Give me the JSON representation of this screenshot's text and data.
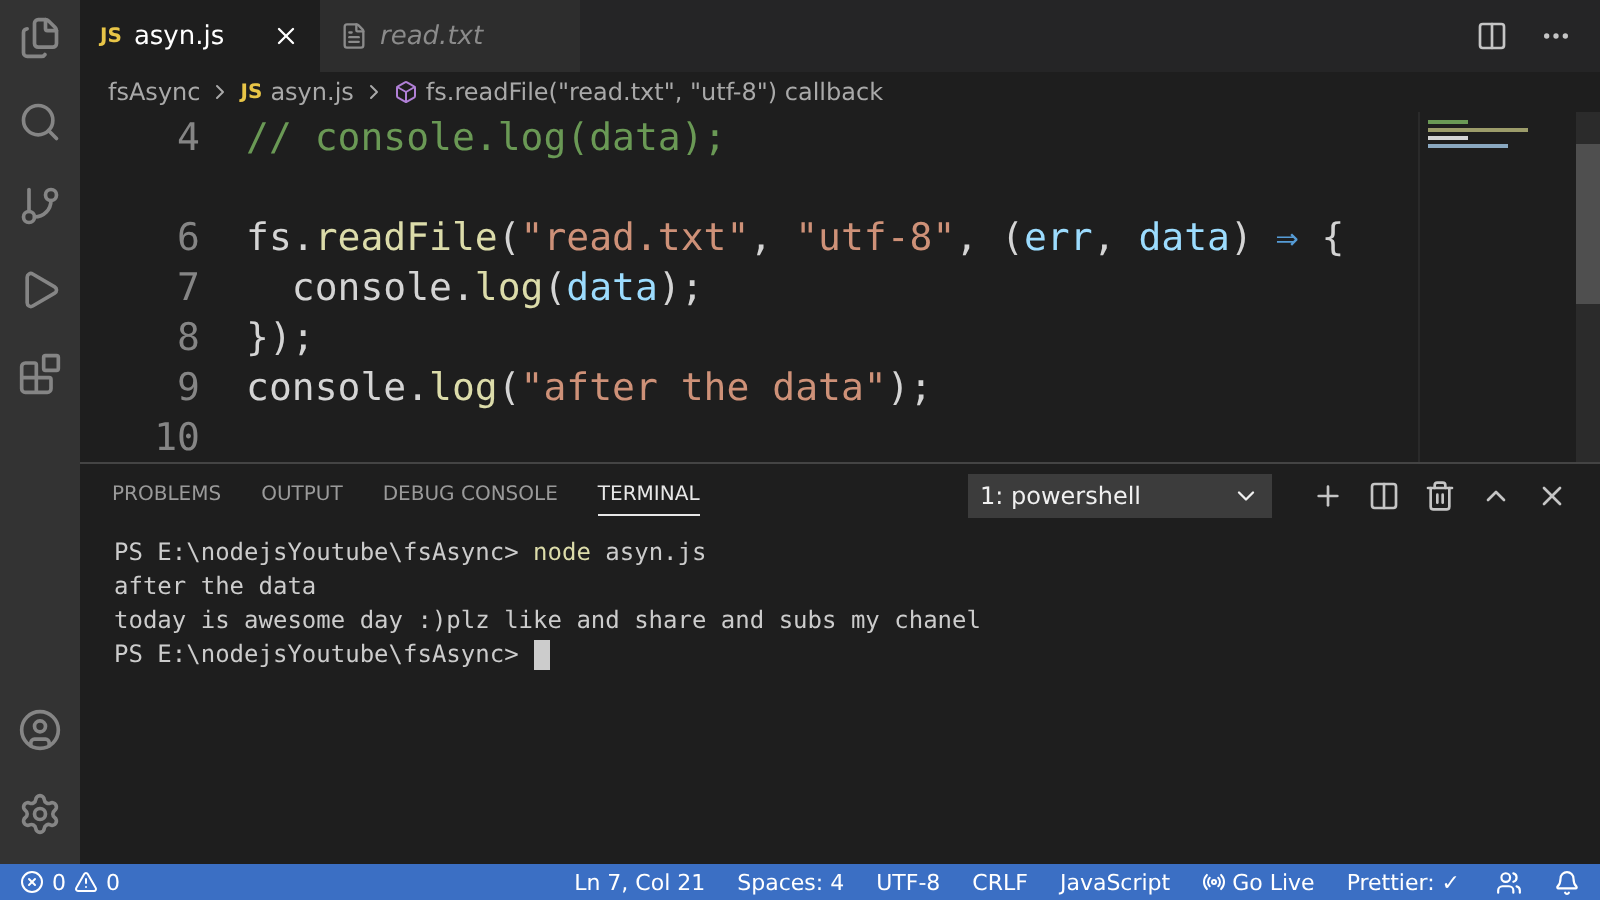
{
  "tabs": [
    {
      "label": "asyn.js",
      "kind": "js",
      "badge": "JS",
      "selected": true
    },
    {
      "label": "read.txt",
      "kind": "txt",
      "selected": false
    }
  ],
  "breadcrumb": [
    {
      "label": "fsAsync",
      "kind": "folder"
    },
    {
      "label": "asyn.js",
      "kind": "js",
      "badge": "JS"
    },
    {
      "label": "fs.readFile(\"read.txt\", \"utf-8\") callback",
      "kind": "symbol"
    }
  ],
  "editor": {
    "lines": [
      {
        "kind": "code",
        "number": "4",
        "tokens": [
          {
            "text": "// console.log(data);",
            "kind": "comment"
          }
        ]
      },
      {
        "kind": "blank"
      },
      {
        "kind": "code",
        "number": "6",
        "tokens": [
          {
            "text": "fs.",
            "kind": "plain"
          },
          {
            "text": "readFile",
            "kind": "func"
          },
          {
            "text": "(",
            "kind": "plain"
          },
          {
            "text": "\"read.txt\"",
            "kind": "string"
          },
          {
            "text": ", ",
            "kind": "plain"
          },
          {
            "text": "\"utf-8\"",
            "kind": "string"
          },
          {
            "text": ", (",
            "kind": "plain"
          },
          {
            "text": "err",
            "kind": "param"
          },
          {
            "text": ", ",
            "kind": "plain"
          },
          {
            "text": "data",
            "kind": "param"
          },
          {
            "text": ") ",
            "kind": "plain"
          },
          {
            "text": "⇒",
            "kind": "keyword"
          },
          {
            "text": " {",
            "kind": "plain"
          }
        ]
      },
      {
        "kind": "code",
        "number": "7",
        "tokens": [
          {
            "text": "  console.",
            "kind": "plain"
          },
          {
            "text": "log",
            "kind": "func"
          },
          {
            "text": "(",
            "kind": "plain"
          },
          {
            "text": "data",
            "kind": "param"
          },
          {
            "text": ");",
            "kind": "plain"
          }
        ]
      },
      {
        "kind": "code",
        "number": "8",
        "tokens": [
          {
            "text": "});",
            "kind": "plain"
          }
        ]
      },
      {
        "kind": "code",
        "number": "9",
        "tokens": [
          {
            "text": "console.",
            "kind": "plain"
          },
          {
            "text": "log",
            "kind": "func"
          },
          {
            "text": "(",
            "kind": "plain"
          },
          {
            "text": "\"after the data\"",
            "kind": "string"
          },
          {
            "text": ");",
            "kind": "plain"
          }
        ]
      },
      {
        "kind": "code",
        "number": "10"
      }
    ]
  },
  "panel": {
    "tabs": [
      {
        "label": "PROBLEMS",
        "selected": false
      },
      {
        "label": "OUTPUT",
        "selected": false
      },
      {
        "label": "DEBUG CONSOLE",
        "selected": false
      },
      {
        "label": "TERMINAL",
        "selected": true
      }
    ],
    "terminal_select": "1: powershell",
    "terminal_lines": [
      {
        "prompt": "PS E:\\nodejsYoutube\\fsAsync> ",
        "command": "node",
        "args": " asyn.js"
      },
      {
        "text": "after the data"
      },
      {
        "text": "today is awesome day :)plz like and share and subs my chanel"
      },
      {
        "prompt": "PS E:\\nodejsYoutube\\fsAsync> ",
        "cursor": true
      }
    ]
  },
  "status_bar": {
    "errors": "0",
    "warnings": "0",
    "items": [
      {
        "label": "Ln 7, Col 21",
        "kind": "text"
      },
      {
        "label": "Spaces: 4",
        "kind": "text"
      },
      {
        "label": "UTF-8",
        "kind": "text"
      },
      {
        "label": "CRLF",
        "kind": "text"
      },
      {
        "label": "JavaScript",
        "kind": "text"
      },
      {
        "label": "Go Live",
        "kind": "live"
      },
      {
        "label": "Prettier: ✓",
        "kind": "text"
      }
    ]
  }
}
